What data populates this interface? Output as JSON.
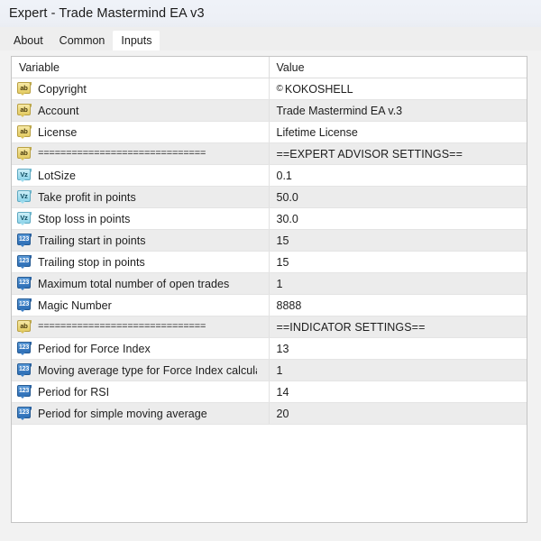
{
  "window": {
    "title": "Expert - Trade Mastermind EA v3"
  },
  "tabs": [
    {
      "label": "About",
      "active": false
    },
    {
      "label": "Common",
      "active": false
    },
    {
      "label": "Inputs",
      "active": true
    }
  ],
  "grid": {
    "headers": {
      "variable": "Variable",
      "value": "Value"
    },
    "rows": [
      {
        "icon": "string-type-icon",
        "icon_text": "ab",
        "variable": "Copyright",
        "value": "© KOKOSHELL"
      },
      {
        "icon": "string-type-icon",
        "icon_text": "ab",
        "variable": "Account",
        "value": "Trade Mastermind EA v.3"
      },
      {
        "icon": "string-type-icon",
        "icon_text": "ab",
        "variable": "License",
        "value": "Lifetime License"
      },
      {
        "icon": "string-type-icon",
        "icon_text": "ab",
        "variable": "==============================",
        "value": "==EXPERT ADVISOR SETTINGS=="
      },
      {
        "icon": "double-type-icon",
        "icon_text": "Vz",
        "variable": "LotSize",
        "value": "0.1"
      },
      {
        "icon": "double-type-icon",
        "icon_text": "Vz",
        "variable": "Take profit in points",
        "value": "50.0"
      },
      {
        "icon": "double-type-icon",
        "icon_text": "Vz",
        "variable": "Stop loss in points",
        "value": "30.0"
      },
      {
        "icon": "int-type-icon",
        "icon_text": "123",
        "variable": "Trailing start in points",
        "value": "15"
      },
      {
        "icon": "int-type-icon",
        "icon_text": "123",
        "variable": "Trailing stop in points",
        "value": "15"
      },
      {
        "icon": "int-type-icon",
        "icon_text": "123",
        "variable": "Maximum total number of open trades",
        "value": "1"
      },
      {
        "icon": "int-type-icon",
        "icon_text": "123",
        "variable": "Magic Number",
        "value": "8888"
      },
      {
        "icon": "string-type-icon",
        "icon_text": "ab",
        "variable": "==============================",
        "value": "==INDICATOR SETTINGS=="
      },
      {
        "icon": "int-type-icon",
        "icon_text": "123",
        "variable": "Period for Force Index",
        "value": "13"
      },
      {
        "icon": "int-type-icon",
        "icon_text": "123",
        "variable": "Moving average type for Force Index calcula…",
        "value": "1"
      },
      {
        "icon": "int-type-icon",
        "icon_text": "123",
        "variable": "Period for RSI",
        "value": "14"
      },
      {
        "icon": "int-type-icon",
        "icon_text": "123",
        "variable": "Period for simple moving average",
        "value": "20"
      }
    ]
  },
  "colors": {
    "titlebar_bg": "#eff2f8",
    "tabstrip_bg": "#eeeeee",
    "content_bg": "#f2f2f2",
    "grid_bg": "#ffffff",
    "row_alt_bg": "#ececec",
    "string_icon": "#ecd87e",
    "double_icon": "#a9e0f0",
    "int_icon": "#3d7fc4",
    "text": "#1d1d1d"
  }
}
